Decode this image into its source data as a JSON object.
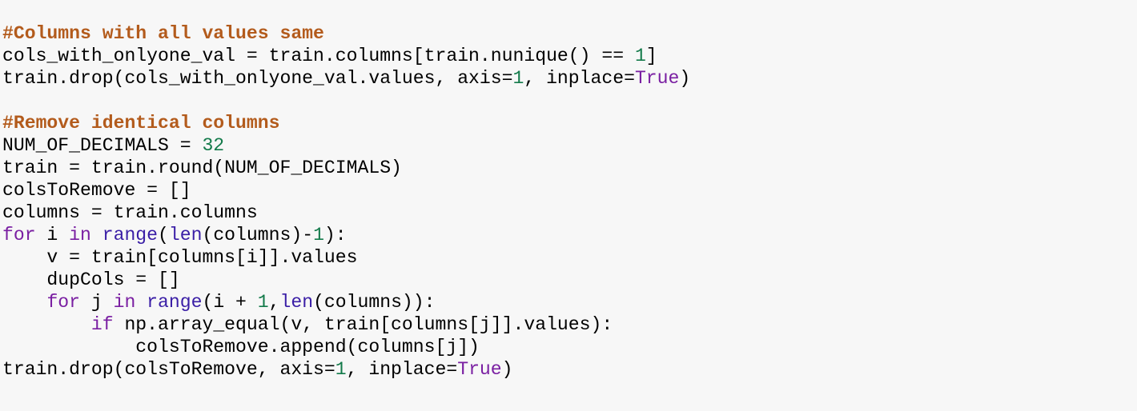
{
  "colors": {
    "background": "#f7f7f7",
    "text": "#000000",
    "comment": "#b35b1c",
    "keyword": "#7a1fa2",
    "builtin": "#3a1ea6",
    "number": "#137a4a"
  },
  "code": {
    "lines": [
      [
        {
          "t": "comment",
          "v": "#Columns with all values same"
        }
      ],
      [
        {
          "t": "text",
          "v": "cols_with_onlyone_val = train.columns[train.nunique() == "
        },
        {
          "t": "number",
          "v": "1"
        },
        {
          "t": "text",
          "v": "]"
        }
      ],
      [
        {
          "t": "text",
          "v": "train.drop(cols_with_onlyone_val.values, axis="
        },
        {
          "t": "number",
          "v": "1"
        },
        {
          "t": "text",
          "v": ", inplace="
        },
        {
          "t": "const",
          "v": "True"
        },
        {
          "t": "text",
          "v": ")"
        }
      ],
      [],
      [
        {
          "t": "comment",
          "v": "#Remove identical columns"
        }
      ],
      [
        {
          "t": "text",
          "v": "NUM_OF_DECIMALS = "
        },
        {
          "t": "number",
          "v": "32"
        }
      ],
      [
        {
          "t": "text",
          "v": "train = train.round(NUM_OF_DECIMALS)"
        }
      ],
      [
        {
          "t": "text",
          "v": "colsToRemove = []"
        }
      ],
      [
        {
          "t": "text",
          "v": "columns = train.columns"
        }
      ],
      [
        {
          "t": "keyword",
          "v": "for"
        },
        {
          "t": "text",
          "v": " i "
        },
        {
          "t": "keyword",
          "v": "in"
        },
        {
          "t": "text",
          "v": " "
        },
        {
          "t": "builtin",
          "v": "range"
        },
        {
          "t": "text",
          "v": "("
        },
        {
          "t": "builtin",
          "v": "len"
        },
        {
          "t": "text",
          "v": "(columns)-"
        },
        {
          "t": "number",
          "v": "1"
        },
        {
          "t": "text",
          "v": "):"
        }
      ],
      [
        {
          "t": "text",
          "v": "    v = train[columns[i]].values"
        }
      ],
      [
        {
          "t": "text",
          "v": "    dupCols = []"
        }
      ],
      [
        {
          "t": "text",
          "v": "    "
        },
        {
          "t": "keyword",
          "v": "for"
        },
        {
          "t": "text",
          "v": " j "
        },
        {
          "t": "keyword",
          "v": "in"
        },
        {
          "t": "text",
          "v": " "
        },
        {
          "t": "builtin",
          "v": "range"
        },
        {
          "t": "text",
          "v": "(i + "
        },
        {
          "t": "number",
          "v": "1"
        },
        {
          "t": "text",
          "v": ","
        },
        {
          "t": "builtin",
          "v": "len"
        },
        {
          "t": "text",
          "v": "(columns)):"
        }
      ],
      [
        {
          "t": "text",
          "v": "        "
        },
        {
          "t": "keyword",
          "v": "if"
        },
        {
          "t": "text",
          "v": " np.array_equal(v, train[columns[j]].values):"
        }
      ],
      [
        {
          "t": "text",
          "v": "            colsToRemove.append(columns[j])"
        }
      ],
      [
        {
          "t": "text",
          "v": "train.drop(colsToRemove, axis="
        },
        {
          "t": "number",
          "v": "1"
        },
        {
          "t": "text",
          "v": ", inplace="
        },
        {
          "t": "const",
          "v": "True"
        },
        {
          "t": "text",
          "v": ")"
        }
      ]
    ]
  }
}
